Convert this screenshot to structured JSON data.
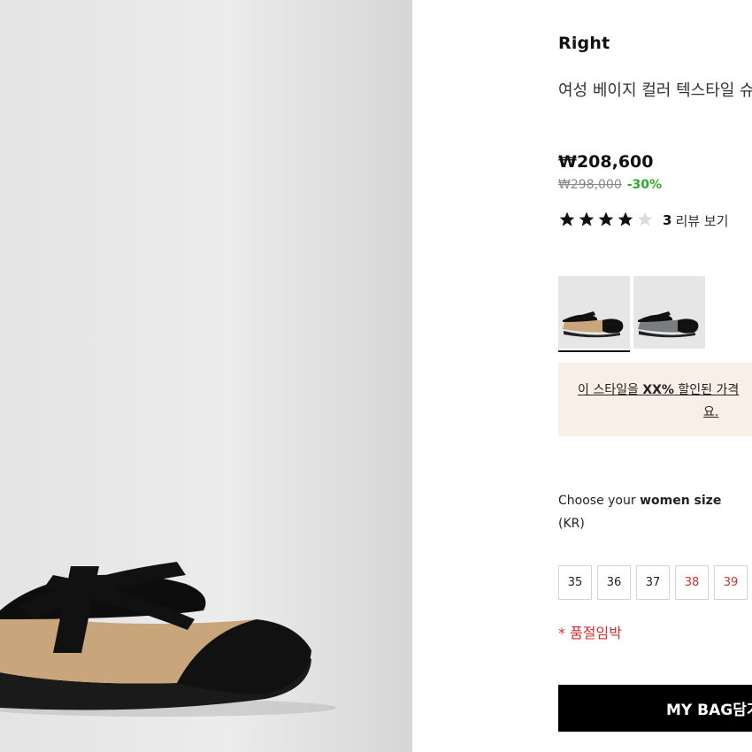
{
  "product": {
    "brand": "Right",
    "name": "여성 베이지 컬러 텍스타일 슈즈",
    "price": "₩208,600",
    "original_price": "₩298,000",
    "discount": "-30%",
    "rating": {
      "stars": 4,
      "max": 5,
      "count": "3",
      "link_label": "리뷰 보기"
    }
  },
  "colors": {
    "accent": "#000000",
    "discount": "#2ea82e",
    "low_stock": "#d0302f",
    "promo_bg": "#f8efe6"
  },
  "variants": [
    {
      "name": "beige-black",
      "active": true
    },
    {
      "name": "grey-black",
      "active": false
    }
  ],
  "promo": {
    "line1_prefix": "이 스타일을 ",
    "line1_bold": "XX%",
    "line1_suffix": " 할인된 가격",
    "line2": "요."
  },
  "size_selector": {
    "label_prefix": "Choose your ",
    "label_bold": "women size",
    "label_suffix": "(KR)",
    "sizes": [
      {
        "label": "35",
        "low_stock": false
      },
      {
        "label": "36",
        "low_stock": false
      },
      {
        "label": "37",
        "low_stock": false
      },
      {
        "label": "38",
        "low_stock": true
      },
      {
        "label": "39",
        "low_stock": true
      }
    ],
    "low_stock_note": "* 품절임박"
  },
  "cart": {
    "button_label": "MY BAG담기"
  }
}
